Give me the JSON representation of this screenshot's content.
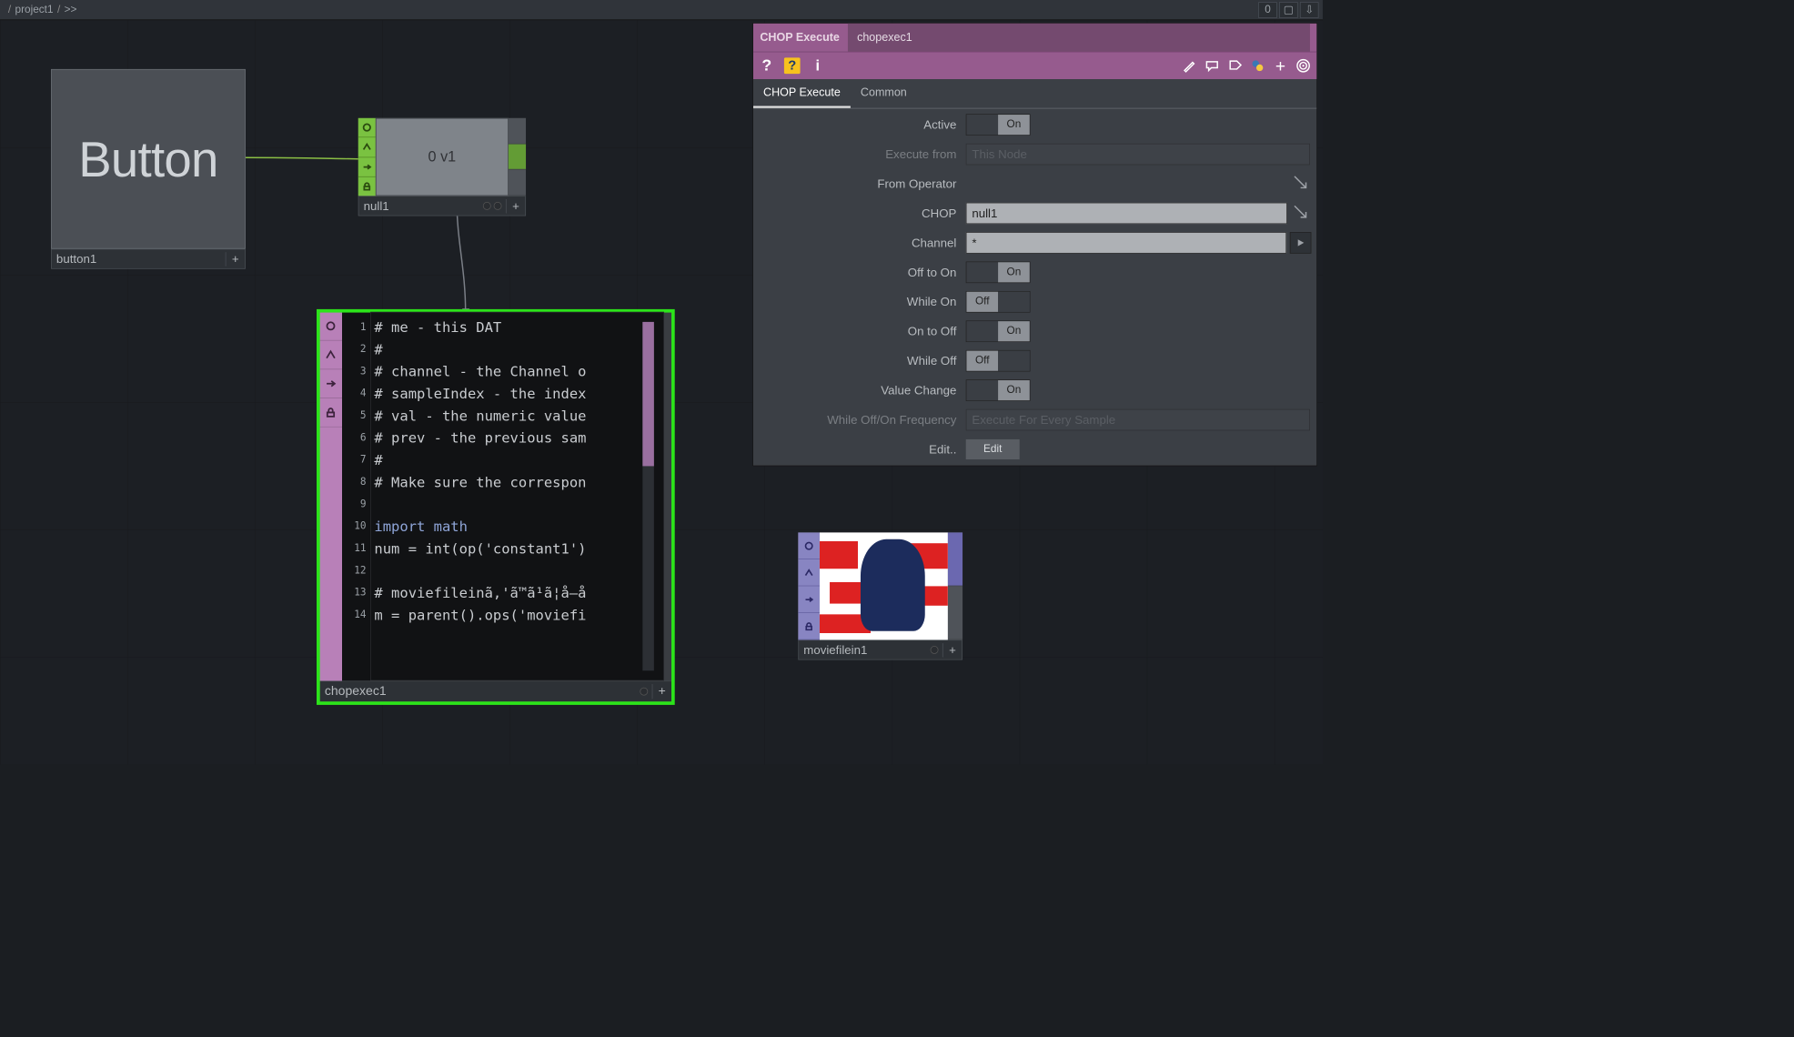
{
  "breadcrumb": {
    "root_sep": "/",
    "path": "project1",
    "tail_sep": "/",
    "tail": ">>"
  },
  "top_icons": [
    "0",
    "▢",
    "⇩"
  ],
  "nodes": {
    "button1": {
      "viewer_text": "Button",
      "label": "button1"
    },
    "null1": {
      "viewer_text": "0 v1",
      "label": "null1"
    },
    "chopexec1": {
      "label": "chopexec1",
      "code_lines": [
        "# me - this DAT",
        "# ",
        "# channel - the Channel o",
        "# sampleIndex - the index",
        "# val - the numeric value",
        "# prev - the previous sam",
        "# ",
        "# Make sure the correspon",
        "",
        "import math",
        "num = int(op('constant1')",
        "",
        "# moviefileinã‚'ã™ã¹ã¦å–å",
        "m = parent().ops('moviefi"
      ]
    },
    "moviefilein1": {
      "label": "moviefilein1"
    }
  },
  "panel": {
    "type_label": "CHOP Execute",
    "op_name": "chopexec1",
    "tabs": [
      "CHOP Execute",
      "Common"
    ],
    "params": {
      "active": {
        "label": "Active",
        "value": "On",
        "state": "on"
      },
      "execute_from": {
        "label": "Execute from",
        "value": "This Node",
        "disabled": true
      },
      "from_operator": {
        "label": "From Operator",
        "value": "",
        "has_arrow": true
      },
      "chop": {
        "label": "CHOP",
        "value": "null1",
        "has_arrow": true
      },
      "channel": {
        "label": "Channel",
        "value": "*",
        "has_play": true
      },
      "off_to_on": {
        "label": "Off to On",
        "value": "On",
        "state": "on"
      },
      "while_on": {
        "label": "While On",
        "value": "Off",
        "state": "off"
      },
      "on_to_off": {
        "label": "On to Off",
        "value": "On",
        "state": "on"
      },
      "while_off": {
        "label": "While Off",
        "value": "Off",
        "state": "off"
      },
      "value_change": {
        "label": "Value Change",
        "value": "On",
        "state": "on"
      },
      "freq": {
        "label": "While Off/On Frequency",
        "value": "Execute For Every Sample",
        "disabled": true
      },
      "edit": {
        "label": "Edit..",
        "button": "Edit"
      }
    }
  }
}
